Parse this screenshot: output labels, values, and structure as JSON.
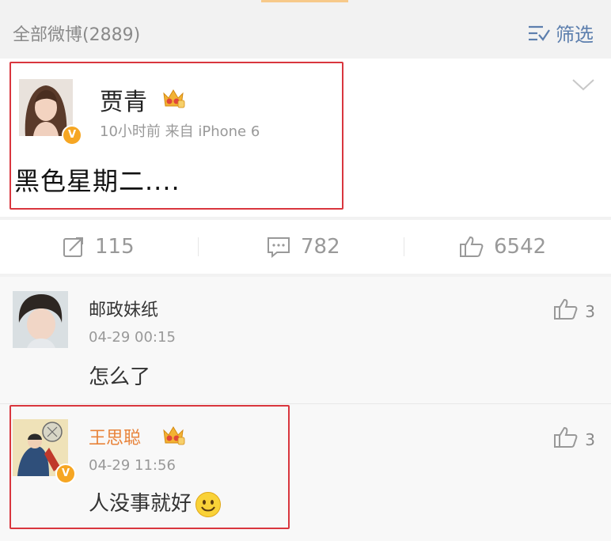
{
  "header": {
    "count_label": "全部微博(2889)",
    "filter_label": "筛选",
    "filter_icon": "filter-icon"
  },
  "post": {
    "author": "贾青",
    "meta": "10小时前  来自 iPhone 6",
    "text": "黑色星期二....",
    "verified_badge": "V",
    "more_icon": "chevron-down-icon"
  },
  "actions": {
    "repost_count": "115",
    "comment_count": "782",
    "like_count": "6542"
  },
  "comments": [
    {
      "name": "邮政妹纸",
      "time": "04-29 00:15",
      "text": "怎么了",
      "likes": "3"
    },
    {
      "name": "王思聪",
      "time": "04-29 11:56",
      "text": "人没事就好",
      "likes": "3",
      "verified_badge": "V",
      "emoji": "smile-emoji"
    }
  ],
  "colors": {
    "highlight_box": "#d9363e",
    "link_blue": "#5d7fae",
    "vip_name": "#e8833a",
    "badge_orange": "#f6a623"
  }
}
